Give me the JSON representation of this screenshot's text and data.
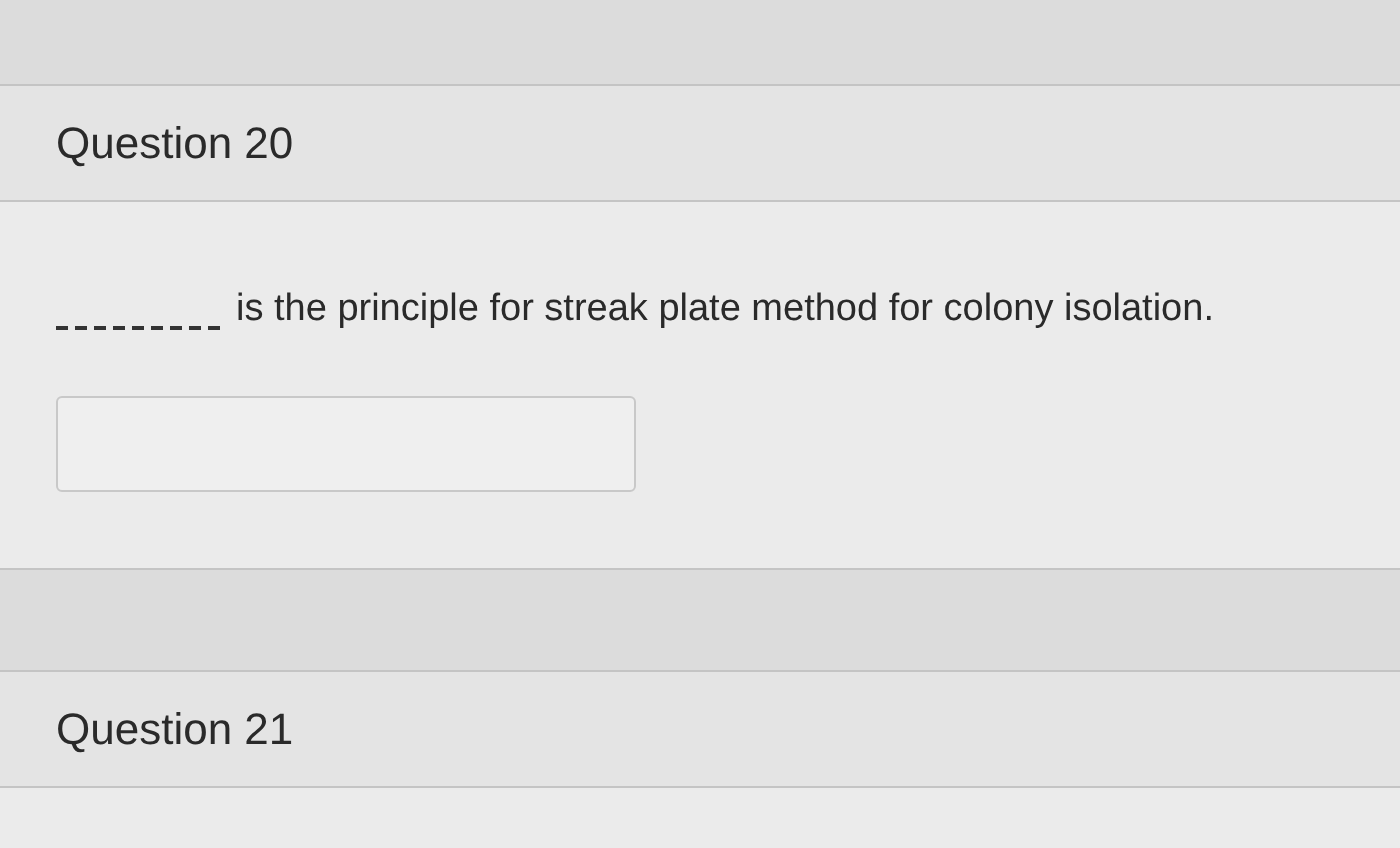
{
  "questions": [
    {
      "title": "Question 20",
      "kind": "fill_in_blank",
      "text": "is the principle for streak plate method for colony isolation."
    },
    {
      "title": "Question 21"
    }
  ]
}
